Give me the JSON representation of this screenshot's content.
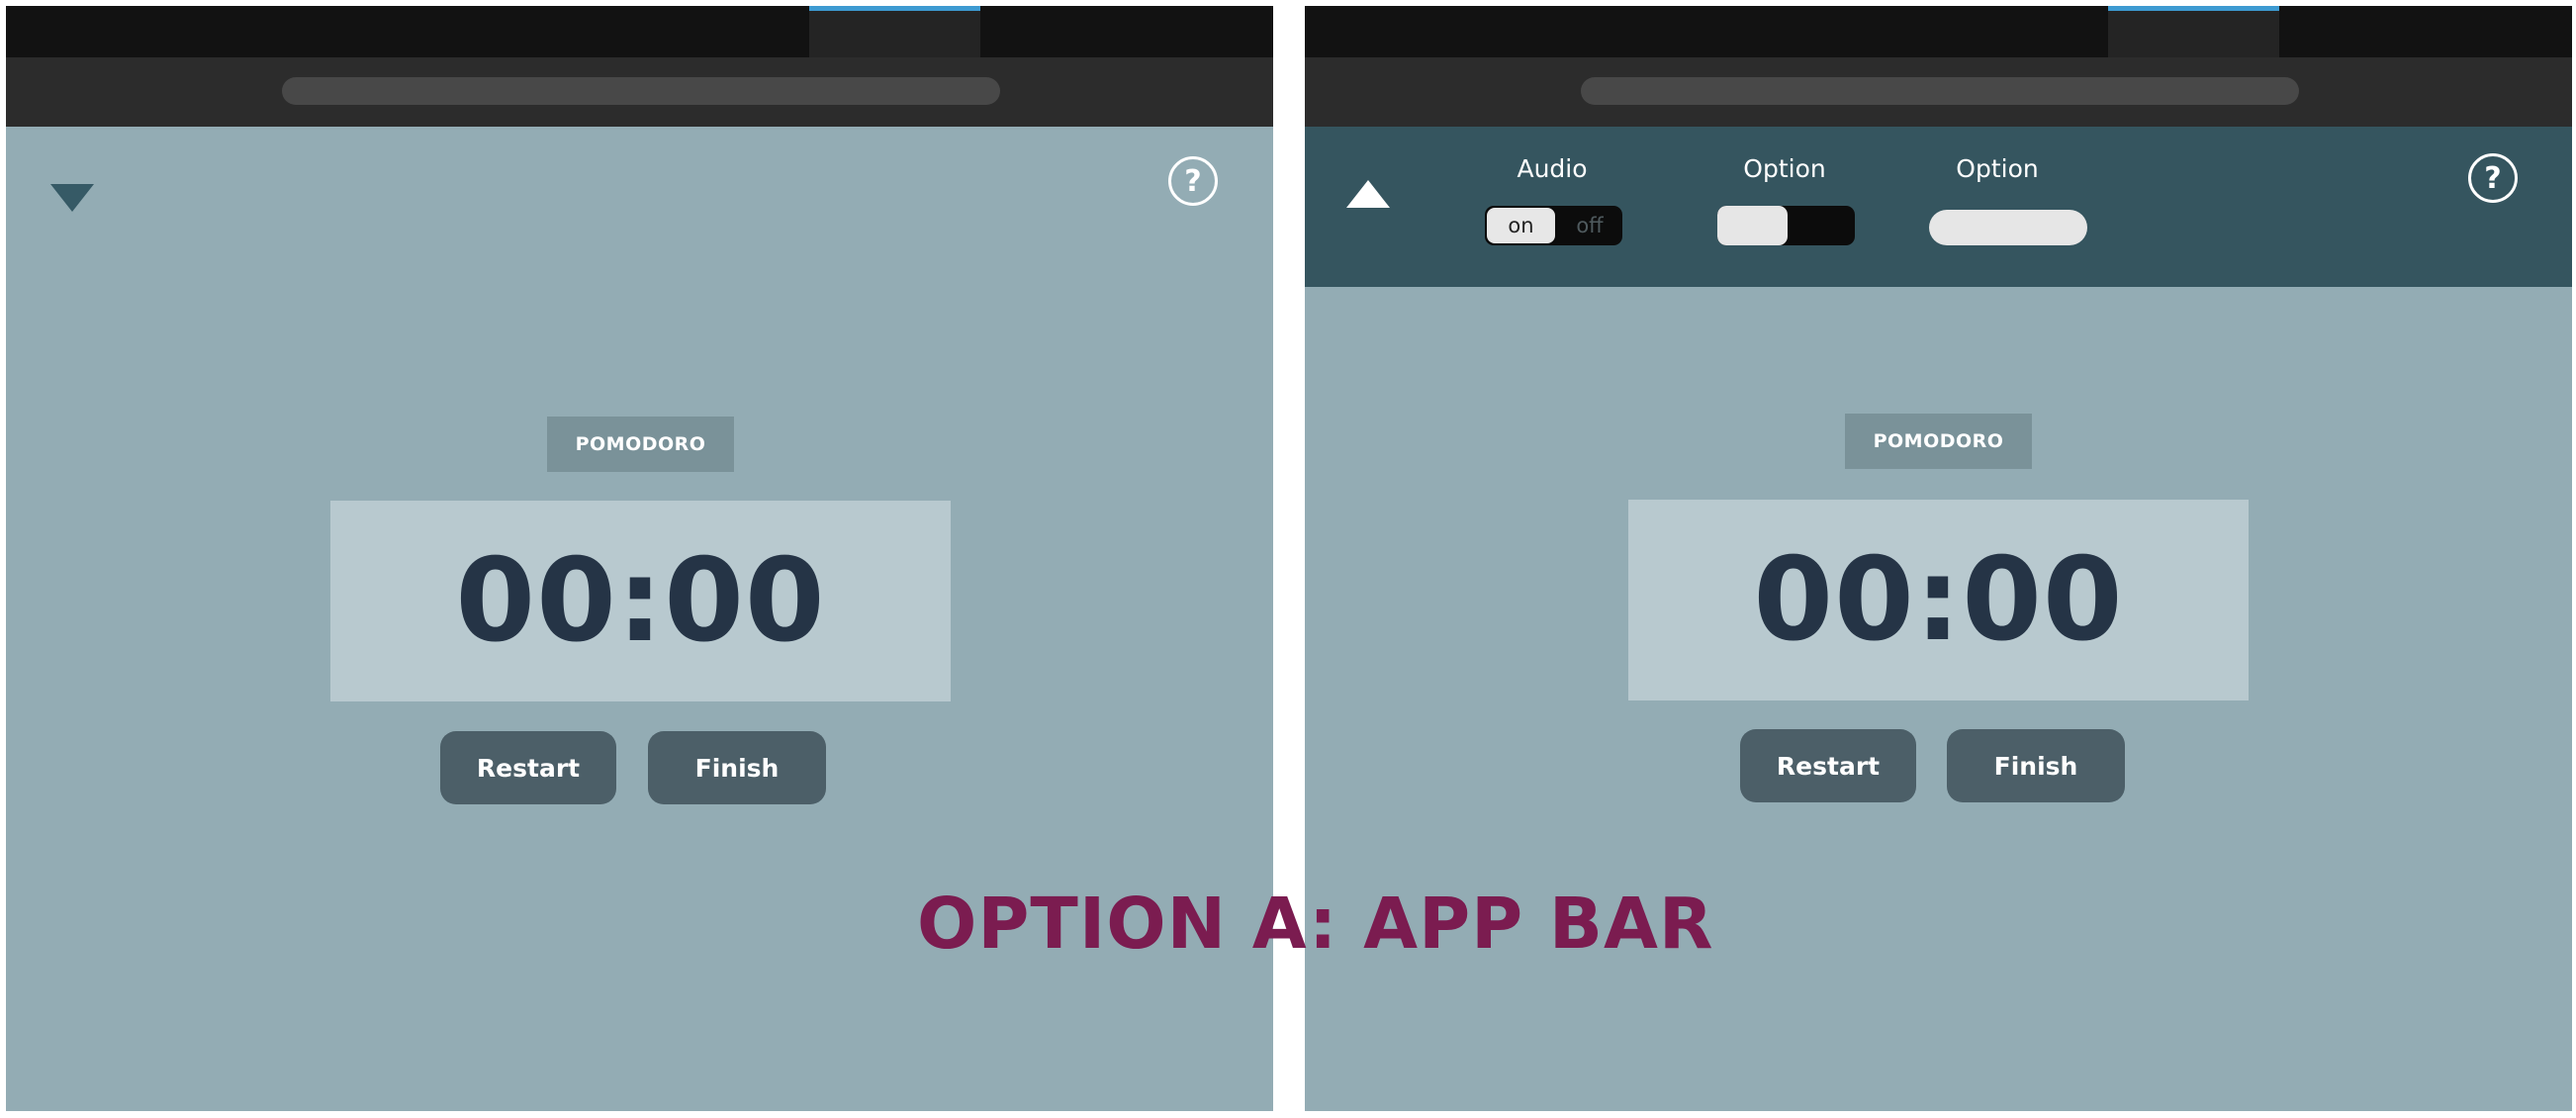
{
  "left_panel": {
    "mode_label": "POMODORO",
    "timer": "00:00",
    "restart_label": "Restart",
    "finish_label": "Finish",
    "help_label": "?"
  },
  "right_panel": {
    "app_bar": {
      "audio_label": "Audio",
      "audio_on": "on",
      "audio_off": "off",
      "option1_label": "Option",
      "option2_label": "Option"
    },
    "mode_label": "POMODORO",
    "timer": "00:00",
    "restart_label": "Restart",
    "finish_label": "Finish",
    "help_label": "?"
  },
  "caption": "OPTION A: APP BAR",
  "colors": {
    "background": "#93acb4",
    "app_bar": "#35555f",
    "timer_box": "#b8c9cf",
    "timer_text": "#253446",
    "button": "#4c5f68",
    "caption": "#7b1c50",
    "tab_indicator": "#3d9ad1"
  },
  "icons": {
    "collapse": "triangle-down-icon",
    "expand": "triangle-up-icon",
    "help": "question-circle-icon"
  }
}
